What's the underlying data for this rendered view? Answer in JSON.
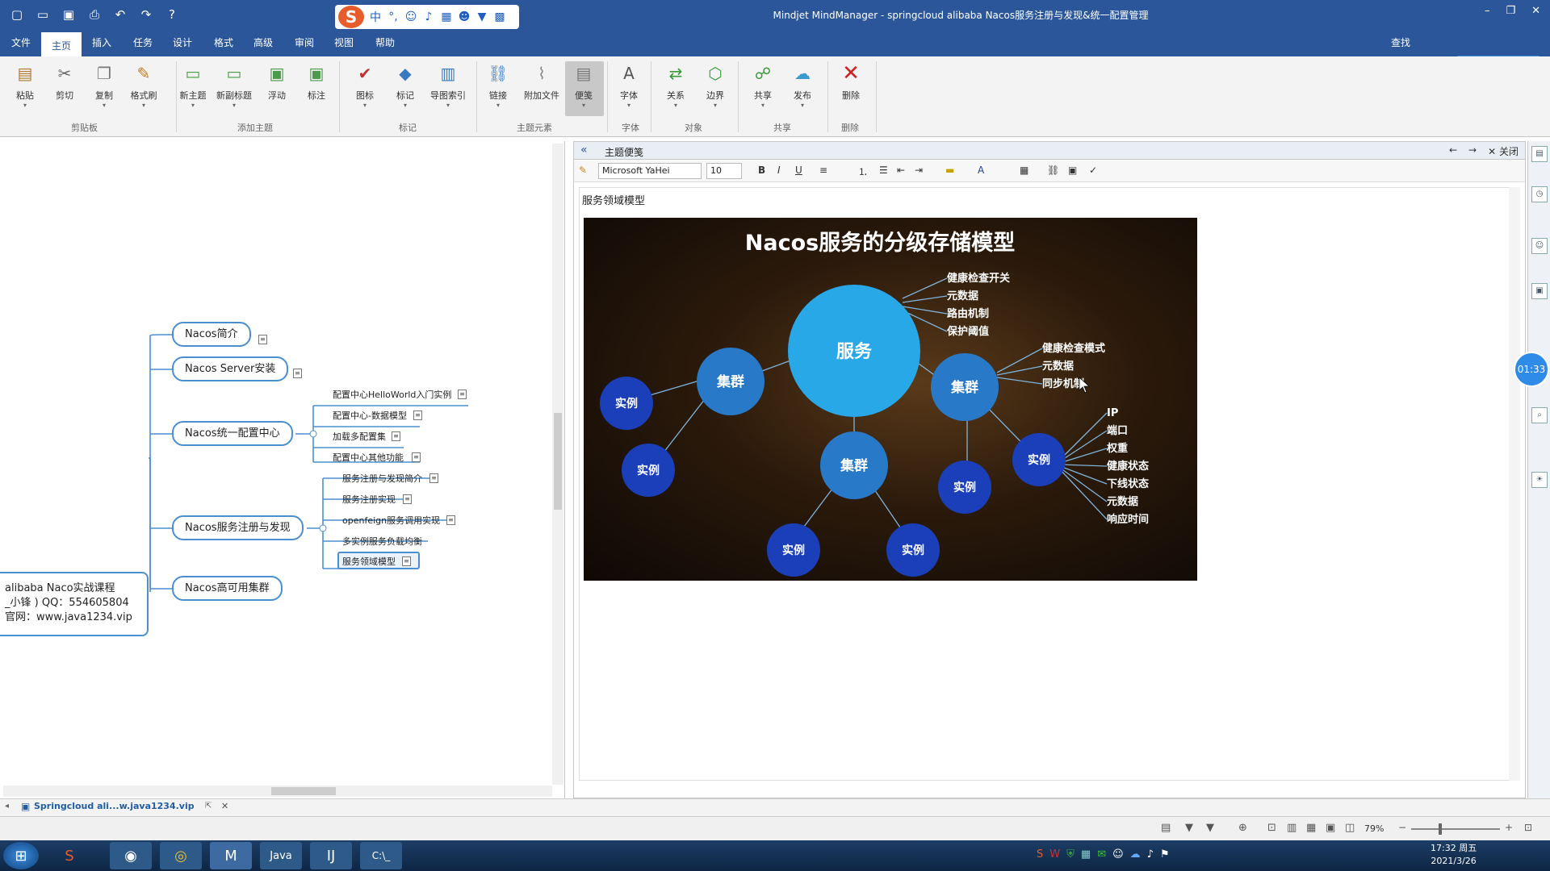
{
  "window": {
    "title": "Mindjet MindManager - springcloud alibaba Nacos服务注册与发现&统一配置管理"
  },
  "menus": [
    "文件",
    "主页",
    "插入",
    "任务",
    "设计",
    "格式",
    "高级",
    "审阅",
    "视图",
    "帮助"
  ],
  "active_menu": "主页",
  "search_label": "查找",
  "ribbon": {
    "buttons": [
      "粘贴",
      "剪切",
      "复制",
      "格式刷",
      "新主题",
      "新副标题",
      "浮动",
      "标注",
      "图标",
      "标记",
      "导图索引",
      "链接",
      "附加文件",
      "便笺",
      "字体",
      "关系",
      "边界",
      "共享",
      "发布",
      "删除"
    ],
    "groups": [
      "剪贴板",
      "添加主题",
      "标记",
      "主题元素",
      "字体",
      "对象",
      "共享",
      "删除"
    ]
  },
  "map": {
    "central": [
      "alibaba Naco实战课程",
      "_小锋 ) QQ：554605804",
      "官网：www.java1234.vip"
    ],
    "topics": [
      "Nacos简介",
      "Nacos Server安装",
      "Nacos统一配置中心",
      "Nacos服务注册与发现",
      "Nacos高可用集群"
    ],
    "config_subs": [
      "配置中心HelloWorld入门实例",
      "配置中心-数据模型",
      "加载多配置集",
      "配置中心其他功能"
    ],
    "discovery_subs": [
      "服务注册与发现简介",
      "服务注册实现",
      "openfeign服务调用实现",
      "多实例服务负载均衡",
      "服务领域模型"
    ]
  },
  "note": {
    "header": "主题便笺",
    "close_label": "关闭",
    "font": "Microsoft YaHei",
    "size": "10",
    "title": "服务领域模型"
  },
  "slide": {
    "title": "Nacos服务的分级存储模型",
    "center": "服务",
    "cluster": "集群",
    "instance": "实例",
    "service_attrs": [
      "健康检查开关",
      "元数据",
      "路由机制",
      "保护阈值"
    ],
    "cluster_attrs": [
      "健康检查模式",
      "元数据",
      "同步机制"
    ],
    "instance_attrs": [
      "IP",
      "端口",
      "权重",
      "健康状态",
      "下线状态",
      "元数据",
      "响应时间"
    ]
  },
  "timer": "01:33",
  "doc_tab": "Springcloud ali...w.java1234.vip",
  "zoom": "79%",
  "clock": {
    "time": "17:32 周五",
    "date": "2021/3/26"
  },
  "colors": {
    "accent": "#2b579a",
    "node_border": "#4a8fd0",
    "circle_service": "#29a8e8",
    "circle_cluster": "#2979c9",
    "circle_instance": "#1a3fb8"
  }
}
